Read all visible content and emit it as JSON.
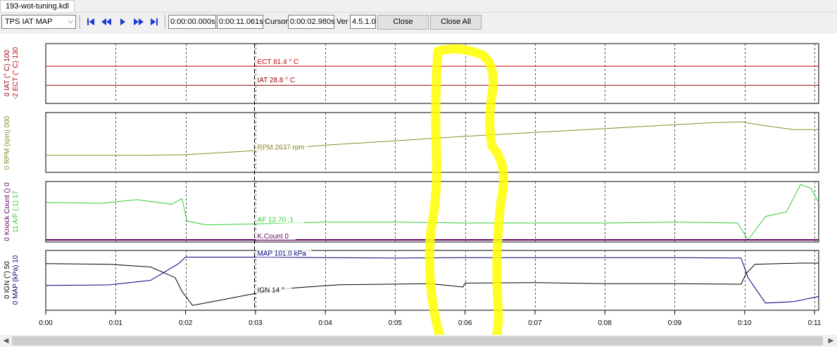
{
  "tab": {
    "title": "193-wot-tuning.kdl"
  },
  "toolbar": {
    "map_select": "TPS IAT MAP",
    "start_time": "0:00:00.000s",
    "end_time": "0:00:11.061s",
    "cursor_label": "Cursor",
    "cursor_time": "0:00:02.980s",
    "ver_label": "Ver",
    "version": "4.5.1.0",
    "close_label": "Close",
    "close_all_label": "Close All"
  },
  "axes": {
    "panel1": {
      "ect_label": "ECT (° C)",
      "ect_max": "130",
      "ect_min": "-2",
      "iat_label": "IAT (° C)",
      "iat_max": "100",
      "iat_min": "0"
    },
    "panel2": {
      "rpm_label": "RPM (rpm)",
      "rpm_max": "000",
      "rpm_min": "0"
    },
    "panel3": {
      "af_label": "A/F (:1)",
      "af_max": "17",
      "af_min": "11",
      "kc_label": "Knock Count ()",
      "kc_max": "0",
      "kc_min": "0"
    },
    "panel4": {
      "map_label": "MAP (kPa)",
      "map_max": "10",
      "map_min": "0",
      "ign_label": "IGN (°)",
      "ign_max": "50",
      "ign_min": "0"
    }
  },
  "cursor_labels": {
    "ect": "ECT 81.4 ° C",
    "iat": "IAT 28.8 ° C",
    "rpm": "RPM 2637 rpm",
    "af": "AF 12.70 :1",
    "kcount": "K.Count 0",
    "map": "MAP 101.0 kPa",
    "ign": "IGN 14 °"
  },
  "time_ticks": [
    "0:00",
    "0:01",
    "0:02",
    "0:03",
    "0:04",
    "0:05",
    "0:06",
    "0:07",
    "0:08",
    "0:09",
    "0:10",
    "0:11"
  ],
  "colors": {
    "ect": "#cc0000",
    "iat": "#990000",
    "rpm": "#8a8a2c",
    "af": "#33cc33",
    "kcount": "#660066",
    "map": "#000080",
    "ign": "#000000",
    "highlight": "#ffff00"
  },
  "chart_data": {
    "type": "line",
    "x_unit": "s",
    "cursor_x": 2.98,
    "series": [
      {
        "name": "ECT",
        "unit": "° C",
        "range": [
          -2,
          130
        ],
        "points": [
          [
            0,
            81.4
          ],
          [
            11.06,
            81.4
          ]
        ]
      },
      {
        "name": "IAT",
        "unit": "° C",
        "range": [
          0,
          100
        ],
        "points": [
          [
            0,
            28.8
          ],
          [
            11.06,
            28.8
          ]
        ]
      },
      {
        "name": "RPM",
        "range": [
          0,
          1
        ],
        "points": [
          [
            0,
            0.27
          ],
          [
            1.4,
            0.27
          ],
          [
            2,
            0.28
          ],
          [
            2.98,
            0.35
          ],
          [
            4,
            0.45
          ],
          [
            5,
            0.53
          ],
          [
            6,
            0.61
          ],
          [
            7,
            0.68
          ],
          [
            8,
            0.75
          ],
          [
            9,
            0.82
          ],
          [
            9.6,
            0.86
          ],
          [
            9.95,
            0.87
          ],
          [
            10.3,
            0.8
          ],
          [
            10.7,
            0.73
          ],
          [
            11.06,
            0.73
          ]
        ]
      },
      {
        "name": "AF",
        "unit": ":1",
        "range": [
          11,
          17
        ],
        "points": [
          [
            0,
            15.0
          ],
          [
            0.8,
            14.9
          ],
          [
            1.3,
            15.3
          ],
          [
            1.8,
            14.8
          ],
          [
            1.95,
            15.4
          ],
          [
            2.02,
            13.0
          ],
          [
            2.3,
            12.6
          ],
          [
            2.98,
            12.7
          ],
          [
            4,
            12.9
          ],
          [
            5,
            12.9
          ],
          [
            6,
            12.8
          ],
          [
            7,
            12.8
          ],
          [
            8,
            12.8
          ],
          [
            9,
            12.9
          ],
          [
            9.9,
            12.8
          ],
          [
            10.05,
            11.0
          ],
          [
            10.3,
            13.5
          ],
          [
            10.6,
            14.0
          ],
          [
            10.8,
            16.9
          ],
          [
            10.95,
            16.5
          ],
          [
            11.06,
            15.0
          ]
        ]
      },
      {
        "name": "K.Count",
        "range": [
          0,
          1
        ],
        "points": [
          [
            0,
            0
          ],
          [
            11.06,
            0
          ]
        ]
      },
      {
        "name": "MAP",
        "unit": "kPa",
        "range": [
          0,
          110
        ],
        "points": [
          [
            0,
            45
          ],
          [
            0.9,
            46
          ],
          [
            1.5,
            55
          ],
          [
            1.9,
            88
          ],
          [
            2.0,
            101
          ],
          [
            2.98,
            101
          ],
          [
            4,
            100
          ],
          [
            5,
            99
          ],
          [
            6,
            100
          ],
          [
            7,
            100
          ],
          [
            8,
            100
          ],
          [
            9,
            100
          ],
          [
            9.95,
            99
          ],
          [
            10.05,
            60
          ],
          [
            10.3,
            10
          ],
          [
            10.7,
            13
          ],
          [
            11.06,
            23
          ]
        ]
      },
      {
        "name": "IGN",
        "range": [
          0,
          1
        ],
        "points": [
          [
            0,
            0.8
          ],
          [
            0.9,
            0.79
          ],
          [
            1.5,
            0.74
          ],
          [
            1.85,
            0.55
          ],
          [
            1.95,
            0.3
          ],
          [
            2.1,
            0.05
          ],
          [
            2.4,
            0.12
          ],
          [
            2.98,
            0.26
          ],
          [
            3.5,
            0.36
          ],
          [
            4.2,
            0.42
          ],
          [
            5.5,
            0.44
          ],
          [
            5.97,
            0.38
          ],
          [
            6.0,
            0.45
          ],
          [
            7,
            0.46
          ],
          [
            8,
            0.44
          ],
          [
            9,
            0.44
          ],
          [
            9.95,
            0.43
          ],
          [
            10.02,
            0.62
          ],
          [
            10.15,
            0.79
          ],
          [
            10.8,
            0.81
          ],
          [
            11.06,
            0.81
          ]
        ]
      }
    ]
  }
}
